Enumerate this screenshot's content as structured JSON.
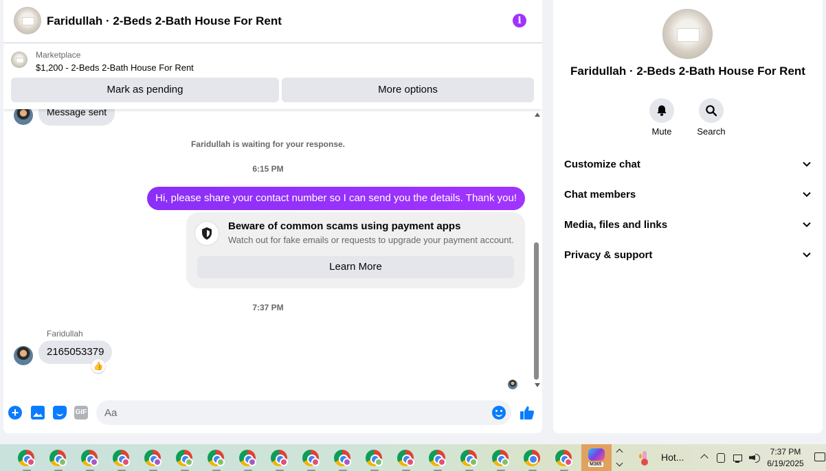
{
  "chat": {
    "title": "Faridullah · 2-Beds 2-Bath House For Rent",
    "marketplace_label": "Marketplace",
    "listing": "$1,200 - 2-Beds 2-Bath House For Rent",
    "mark_pending": "Mark as pending",
    "more_options": "More options"
  },
  "thread": {
    "previous_message": "Message sent",
    "waiting_notice": "Faridullah is waiting for your response.",
    "time1": "6:15 PM",
    "outgoing_message": "Hi, please share your contact number so I can send you the details. Thank you!",
    "scam_title": "Beware of common scams using payment apps",
    "scam_subtitle": "Watch out for fake emails or requests to upgrade your payment account.",
    "learn_more": "Learn More",
    "time2": "7:37 PM",
    "sender_name": "Faridullah",
    "incoming_message": "2165053379",
    "reaction": "👍"
  },
  "composer": {
    "placeholder": "Aa",
    "gif_label": "GIF"
  },
  "info_panel": {
    "title": "Faridullah · 2-Beds 2-Bath House For Rent",
    "mute_label": "Mute",
    "search_label": "Search",
    "sections": [
      "Customize chat",
      "Chat members",
      "Media, files and links",
      "Privacy & support"
    ]
  },
  "taskbar": {
    "apps": [
      {
        "icon": "chrome-icon",
        "profile_color": "#e0507a"
      },
      {
        "icon": "chrome-icon",
        "profile_color": "#7fbf6a"
      },
      {
        "icon": "chrome-icon",
        "profile_color": "#a45ac8"
      },
      {
        "icon": "chrome-icon",
        "profile_color": "#e0507a"
      },
      {
        "icon": "chrome-icon",
        "profile_color": "#a45ac8"
      },
      {
        "icon": "chrome-icon",
        "profile_color": "#7fbf6a"
      },
      {
        "icon": "chrome-icon",
        "profile_color": "#7fbf6a"
      },
      {
        "icon": "chrome-icon",
        "profile_color": "#a45ac8"
      },
      {
        "icon": "chrome-icon",
        "profile_color": "#e0507a"
      },
      {
        "icon": "chrome-icon",
        "profile_color": "#e0507a"
      },
      {
        "icon": "chrome-icon",
        "profile_color": "#a45ac8"
      },
      {
        "icon": "chrome-icon",
        "profile_color": "#7fbf6a"
      },
      {
        "icon": "chrome-icon",
        "profile_color": "#e0507a"
      },
      {
        "icon": "chrome-icon",
        "profile_color": "#e0507a"
      },
      {
        "icon": "chrome-icon",
        "profile_color": "#7fbf6a"
      },
      {
        "icon": "chrome-icon",
        "profile_color": "#7fbf6a"
      },
      {
        "icon": "chrome-icon",
        "profile_color": ""
      },
      {
        "icon": "chrome-icon",
        "profile_color": "#e0507a"
      }
    ],
    "m365_label": "M365",
    "weather_text": "Hot...",
    "time": "7:37 PM",
    "date": "6/19/2025"
  },
  "colors": {
    "accent": "#a033ff",
    "messenger_blue": "#0a7cff"
  }
}
